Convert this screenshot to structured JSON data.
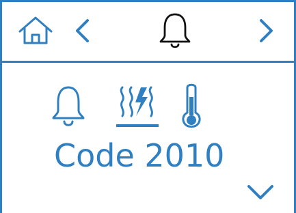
{
  "colors": {
    "accent": "#2f7fc1",
    "header_icon": "#111111",
    "background": "#ffffff"
  },
  "header": {
    "home_icon": "home-icon",
    "prev_icon": "chevron-left-icon",
    "center_icon": "bell-icon",
    "next_icon": "chevron-right-icon"
  },
  "main": {
    "status_icons": [
      "bell-icon",
      "heating-icon",
      "thermometer-icon"
    ],
    "code_text": "Code 2010",
    "down_icon": "chevron-down-icon"
  }
}
